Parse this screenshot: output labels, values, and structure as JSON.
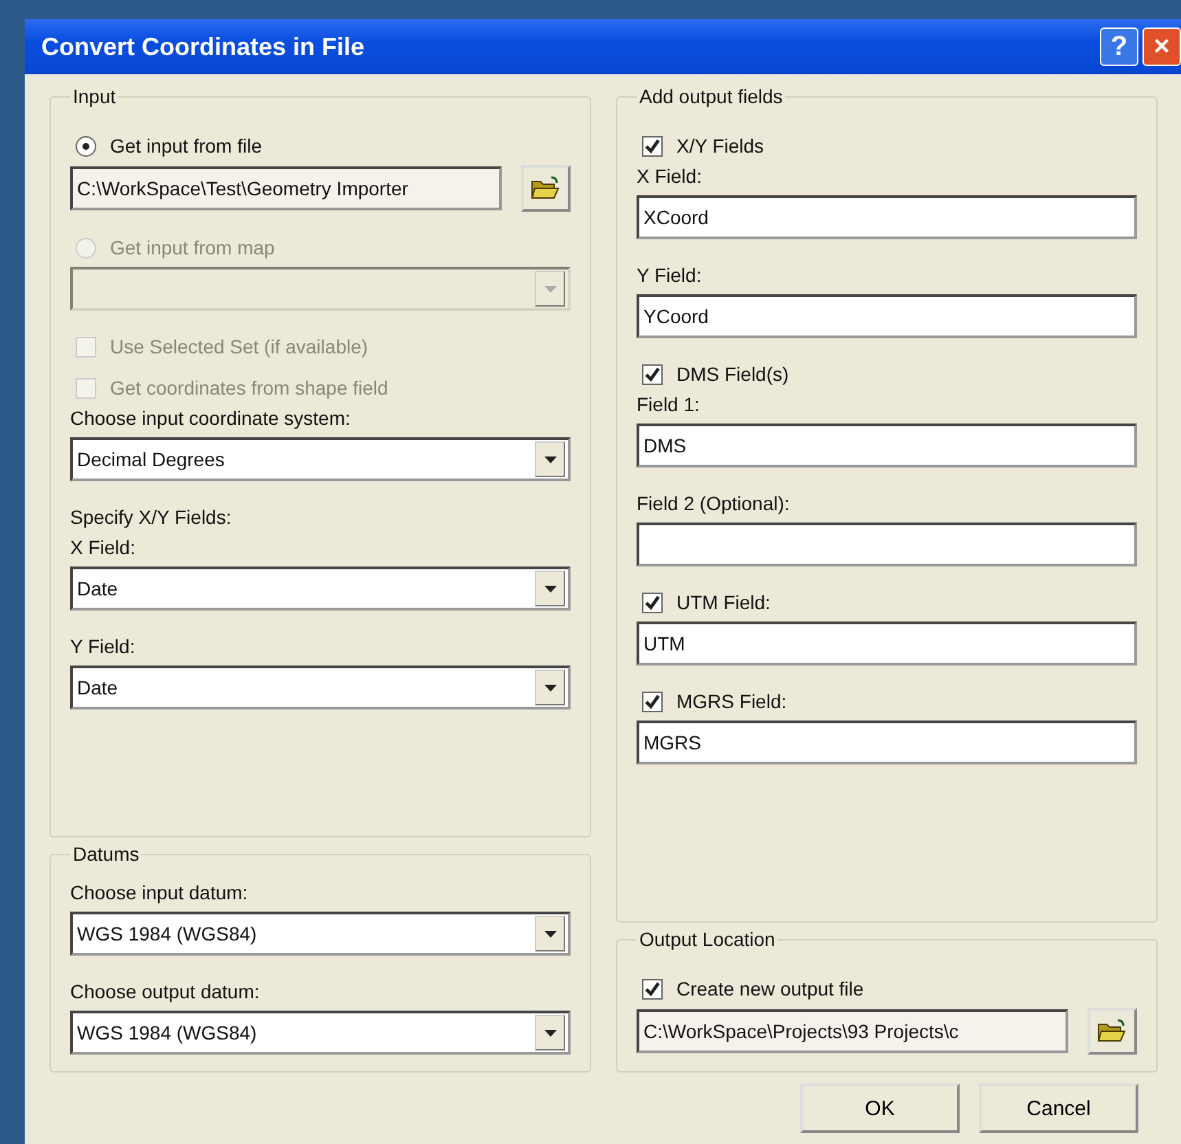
{
  "window": {
    "title": "Convert Coordinates in File",
    "help": "?",
    "close": "×"
  },
  "input": {
    "legend": "Input",
    "items": [
      {
        "kind": "radio",
        "label": "Get input from file",
        "selected": true,
        "disabled": false
      },
      {
        "kind": "path",
        "value": "C:\\WorkSpace\\Test\\Geometry Importer",
        "disabled": false
      },
      {
        "kind": "radio",
        "label": "Get input from map",
        "selected": false,
        "disabled": true
      },
      {
        "kind": "dropdown",
        "disabled": true
      },
      {
        "kind": "checkbox",
        "label": "Use Selected Set (if available)",
        "checked": false,
        "disabled": true
      },
      {
        "kind": "checkbox",
        "label": "Get coordinates from shape field",
        "checked": false,
        "disabled": true
      },
      {
        "kind": "caption",
        "label": "Choose input coordinate system:"
      },
      {
        "kind": "dropdown",
        "value": "Decimal Degrees",
        "disabled": false
      },
      {
        "kind": "caption",
        "label": "Specify X/Y Fields:"
      },
      {
        "kind": "caption",
        "label": "X Field:"
      },
      {
        "kind": "dropdown",
        "value": "Date",
        "disabled": false
      },
      {
        "kind": "caption",
        "label": "Y Field:"
      },
      {
        "kind": "dropdown",
        "value": "Date",
        "disabled": false
      }
    ]
  },
  "datums": {
    "legend": "Datums",
    "items": [
      {
        "kind": "caption",
        "label": "Choose input datum:"
      },
      {
        "kind": "dropdown",
        "value": "WGS 1984 (WGS84)",
        "disabled": false
      },
      {
        "kind": "caption",
        "label": "Choose output datum:"
      },
      {
        "kind": "dropdown",
        "value": "WGS 1984 (WGS84)",
        "disabled": false
      }
    ]
  },
  "output_fields": {
    "legend": "Add output fields",
    "items": [
      {
        "kind": "checkbox",
        "label": "X/Y Fields",
        "checked": true,
        "disabled": false
      },
      {
        "kind": "caption",
        "label": "X Field:"
      },
      {
        "kind": "text",
        "value": "XCoord",
        "disabled": false
      },
      {
        "kind": "caption",
        "label": "Y Field:"
      },
      {
        "kind": "text",
        "value": "YCoord",
        "disabled": false
      },
      {
        "kind": "checkbox",
        "label": "DMS Field(s)",
        "checked": true,
        "disabled": false
      },
      {
        "kind": "caption",
        "label": "Field 1:"
      },
      {
        "kind": "text",
        "value": "DMS",
        "disabled": false
      },
      {
        "kind": "caption",
        "label": "Field 2 (Optional):"
      },
      {
        "kind": "text",
        "disabled": false
      },
      {
        "kind": "checkbox",
        "label": "UTM Field:",
        "checked": true,
        "disabled": false
      },
      {
        "kind": "text",
        "value": "UTM",
        "disabled": false
      },
      {
        "kind": "checkbox",
        "label": "MGRS Field:",
        "checked": true,
        "disabled": false
      },
      {
        "kind": "text",
        "value": "MGRS",
        "disabled": false
      }
    ]
  },
  "output_location": {
    "legend": "Output Location",
    "items": [
      {
        "kind": "checkbox",
        "label": "Create new output file",
        "checked": true,
        "disabled": false
      },
      {
        "kind": "path",
        "value": "C:\\WorkSpace\\Projects\\93 Projects\\c",
        "disabled": false
      }
    ]
  },
  "buttons": [
    "OK",
    "Cancel"
  ]
}
